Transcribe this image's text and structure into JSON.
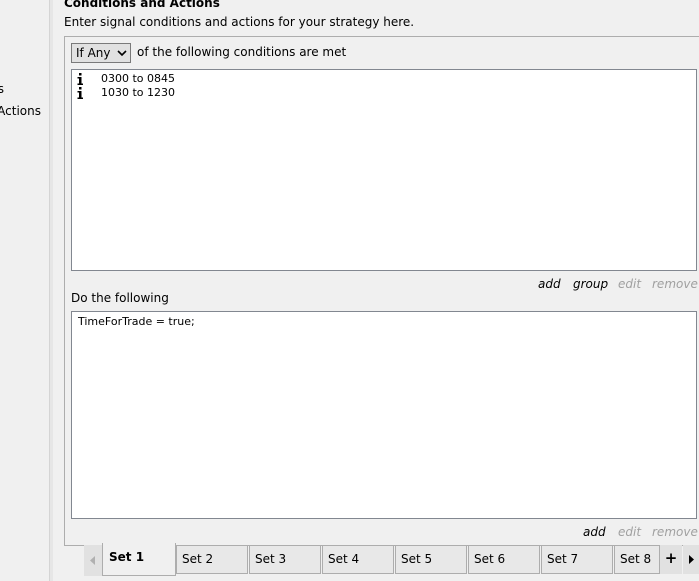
{
  "nav": {
    "item1": "s",
    "item2": "Actions"
  },
  "section": {
    "title": "Conditions and Actions",
    "description": "Enter signal conditions and actions for your strategy here."
  },
  "conditions": {
    "mode_selected": "If Any",
    "mode_suffix": "of the following conditions are met",
    "items": [
      {
        "icon": "info-icon",
        "label": "0300 to 0845"
      },
      {
        "icon": "info-icon",
        "label": "1030 to 1230"
      }
    ],
    "actions": {
      "add": "add",
      "group": "group",
      "edit": "edit",
      "remove": "remove"
    }
  },
  "do_following": {
    "label": "Do the following",
    "code": "TimeForTrade = true;",
    "actions": {
      "add": "add",
      "edit": "edit",
      "remove": "remove"
    }
  },
  "tabs": [
    {
      "label": "Set 1",
      "active": true
    },
    {
      "label": "Set 2"
    },
    {
      "label": "Set 3"
    },
    {
      "label": "Set 4"
    },
    {
      "label": "Set 5"
    },
    {
      "label": "Set 6"
    },
    {
      "label": "Set 7"
    },
    {
      "label": "Set 8"
    }
  ],
  "tab_add_label": "+",
  "colors": {
    "background": "#f0f0f0",
    "disabled_link": "#a0a0a0",
    "border": "#adadad"
  }
}
